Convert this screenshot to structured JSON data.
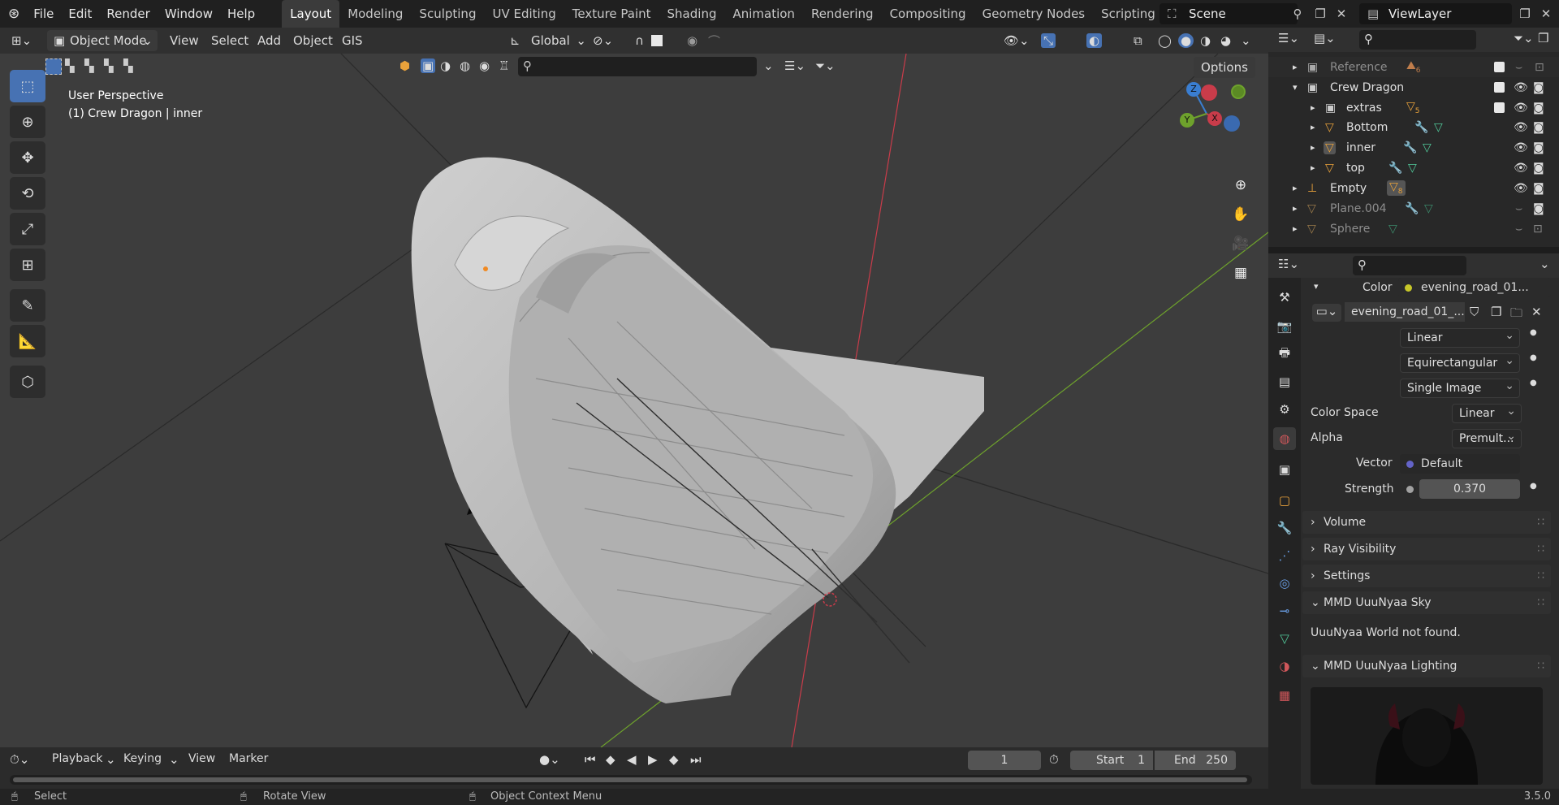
{
  "topbar": {
    "menus": [
      "File",
      "Edit",
      "Render",
      "Window",
      "Help"
    ],
    "workspaces": [
      "Layout",
      "Modeling",
      "Sculpting",
      "UV Editing",
      "Texture Paint",
      "Shading",
      "Animation",
      "Rendering",
      "Compositing",
      "Geometry Nodes",
      "Scripting"
    ],
    "active_workspace": "Layout",
    "scene": "Scene",
    "view_layer": "ViewLayer"
  },
  "viewport_header": {
    "mode": "Object Mode",
    "menus": [
      "View",
      "Select",
      "Add",
      "Object",
      "GIS"
    ],
    "orientation": "Global",
    "options": "Options"
  },
  "viewport": {
    "perspective": "User Perspective",
    "object_info": "(1) Crew Dragon | inner",
    "gizmo": {
      "z": "Z",
      "y": "Y",
      "x": "X"
    }
  },
  "outliner": {
    "rows": [
      {
        "name": "Reference",
        "badge": "6",
        "dim": true,
        "level": 0
      },
      {
        "name": "Crew Dragon",
        "dim": false,
        "level": 0
      },
      {
        "name": "extras",
        "badge": "5",
        "dim": false,
        "level": 1
      },
      {
        "name": "Bottom",
        "dim": false,
        "level": 1
      },
      {
        "name": "inner",
        "dim": false,
        "level": 1
      },
      {
        "name": "top",
        "dim": false,
        "level": 1
      },
      {
        "name": "Empty",
        "badge": "8",
        "dim": false,
        "level": 0
      },
      {
        "name": "Plane.004",
        "dim": true,
        "level": 0
      },
      {
        "name": "Sphere",
        "dim": true,
        "level": 0
      }
    ]
  },
  "properties": {
    "color_label": "Color",
    "color_value": "evening_road_01...",
    "image_name": "evening_road_01_...",
    "interpolation": "Linear",
    "projection": "Equirectangular",
    "source": "Single Image",
    "color_space_label": "Color Space",
    "color_space": "Linear",
    "alpha_label": "Alpha",
    "alpha": "Premult...",
    "vector_label": "Vector",
    "vector": "Default",
    "strength_label": "Strength",
    "strength": "0.370",
    "panels": [
      "Volume",
      "Ray Visibility",
      "Settings"
    ],
    "mmd_sky": "MMD UuuNyaa Sky",
    "mmd_sky_msg": "UuuNyaa World not found.",
    "mmd_lighting": "MMD UuuNyaa Lighting"
  },
  "timeline": {
    "menus": [
      "Playback",
      "Keying",
      "View",
      "Marker"
    ],
    "current_frame": "1",
    "start_label": "Start",
    "start": "1",
    "end_label": "End",
    "end": "250"
  },
  "status": {
    "select": "Select",
    "rotate": "Rotate View",
    "context": "Object Context Menu",
    "version": "3.5.0"
  },
  "colors": {
    "accent": "#4772b3",
    "x_axis": "#c93c4a",
    "y_axis": "#6ea22c",
    "z_axis": "#3a7ed1"
  }
}
